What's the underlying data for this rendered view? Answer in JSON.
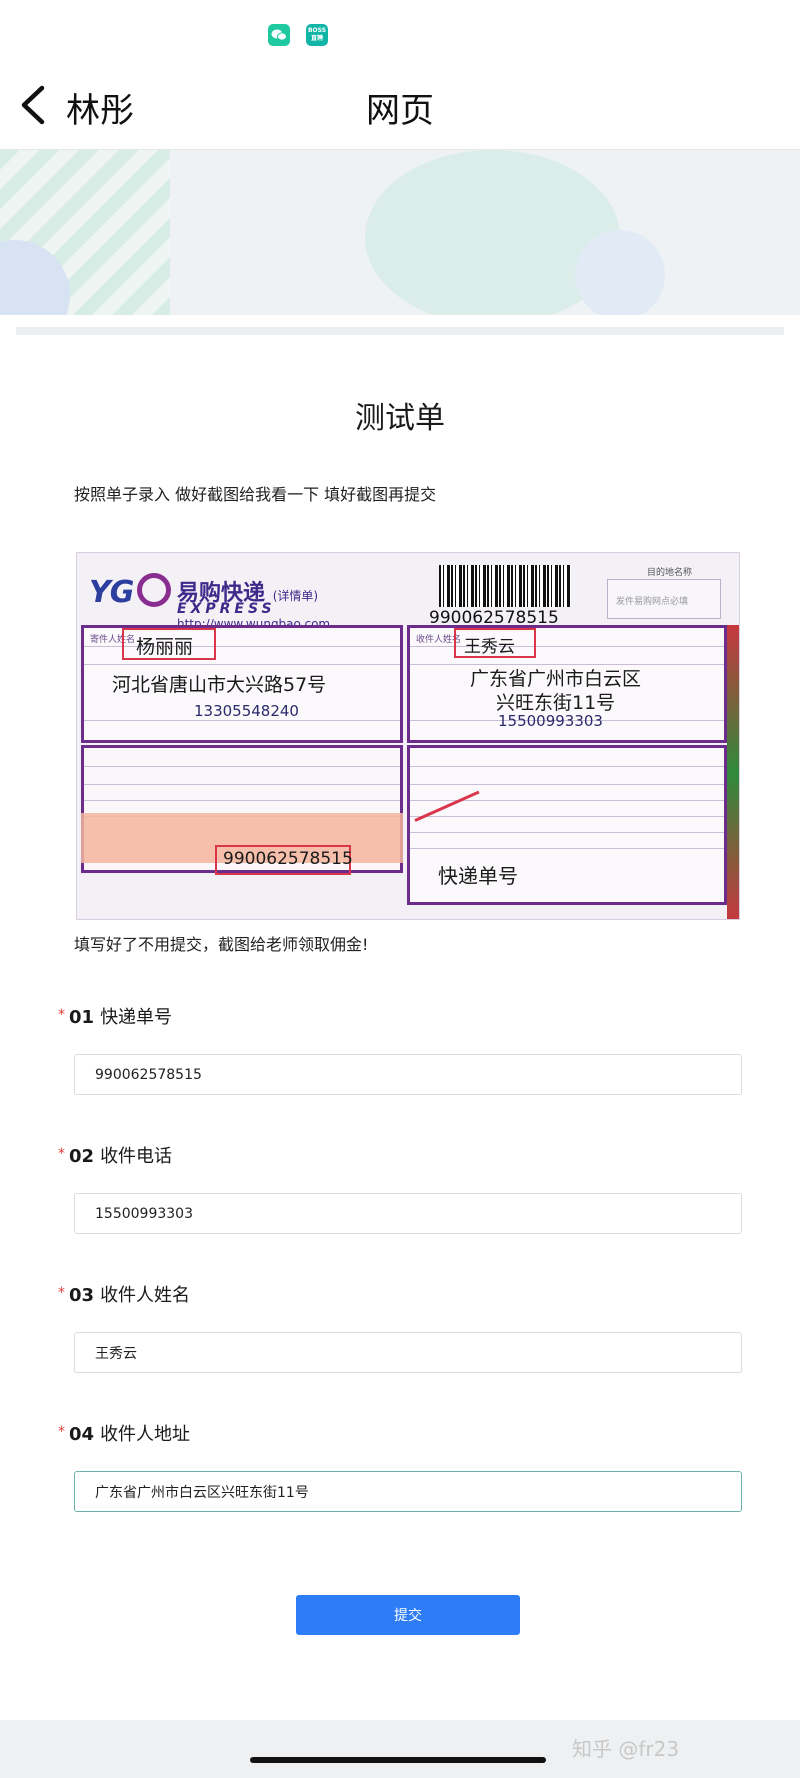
{
  "status_bar": {
    "icons": [
      {
        "name": "wechat-icon",
        "text": ""
      },
      {
        "name": "boss-app-icon",
        "text": "BOSS\n直聘"
      }
    ]
  },
  "nav": {
    "contact_name": "林彤",
    "title": "网页"
  },
  "form": {
    "title": "测试单",
    "description": "按照单子录入 做好截图给我看一下 填好截图再提交",
    "note": "填写好了不用提交，截图给老师领取佣金!"
  },
  "waybill": {
    "brand": "易购快递",
    "brand_sub": "(详情单)",
    "express": "EXPRESS",
    "url": "http://www.wungbao.com",
    "logo": "YG",
    "tracking_number": "990062578515",
    "dest_label": "目的地名称",
    "dest_note": "发件易购网点必填",
    "sender_label": "寄件人姓名",
    "sender_name": "杨丽丽",
    "sender_address": "河北省唐山市大兴路57号",
    "sender_phone": "13305548240",
    "recipient_label": "收件人姓名",
    "recipient_name": "王秀云",
    "recipient_address_line1": "广东省广州市白云区",
    "recipient_address_line2": "兴旺东街11号",
    "recipient_phone": "15500993303",
    "tracking_bottom": "990062578515",
    "annotation": "快递单号"
  },
  "questions": [
    {
      "num": "01",
      "label": "快递单号",
      "value": "990062578515"
    },
    {
      "num": "02",
      "label": "收件电话",
      "value": "15500993303"
    },
    {
      "num": "03",
      "label": "收件人姓名",
      "value": "王秀云"
    },
    {
      "num": "04",
      "label": "收件人地址",
      "value": "广东省广州市白云区兴旺东街11号"
    }
  ],
  "required_mark": "*",
  "submit_label": "提交",
  "watermark": "知乎 @fr23"
}
